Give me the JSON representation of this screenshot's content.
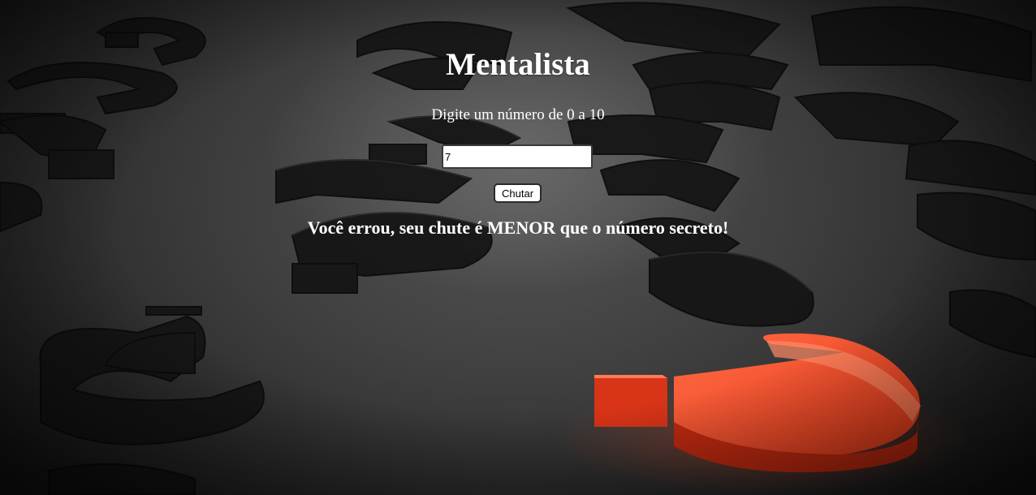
{
  "page": {
    "title": "Mentalista",
    "prompt": "Digite um número de 0 a 10",
    "input_value": "7",
    "button_label": "Chutar",
    "result_message": "Você errou, seu chute é MENOR que o número secreto!"
  },
  "background": {
    "description_icon": "question-marks-background",
    "accent_color": "#ff4a25",
    "dark_color": "#1a1a1a"
  }
}
